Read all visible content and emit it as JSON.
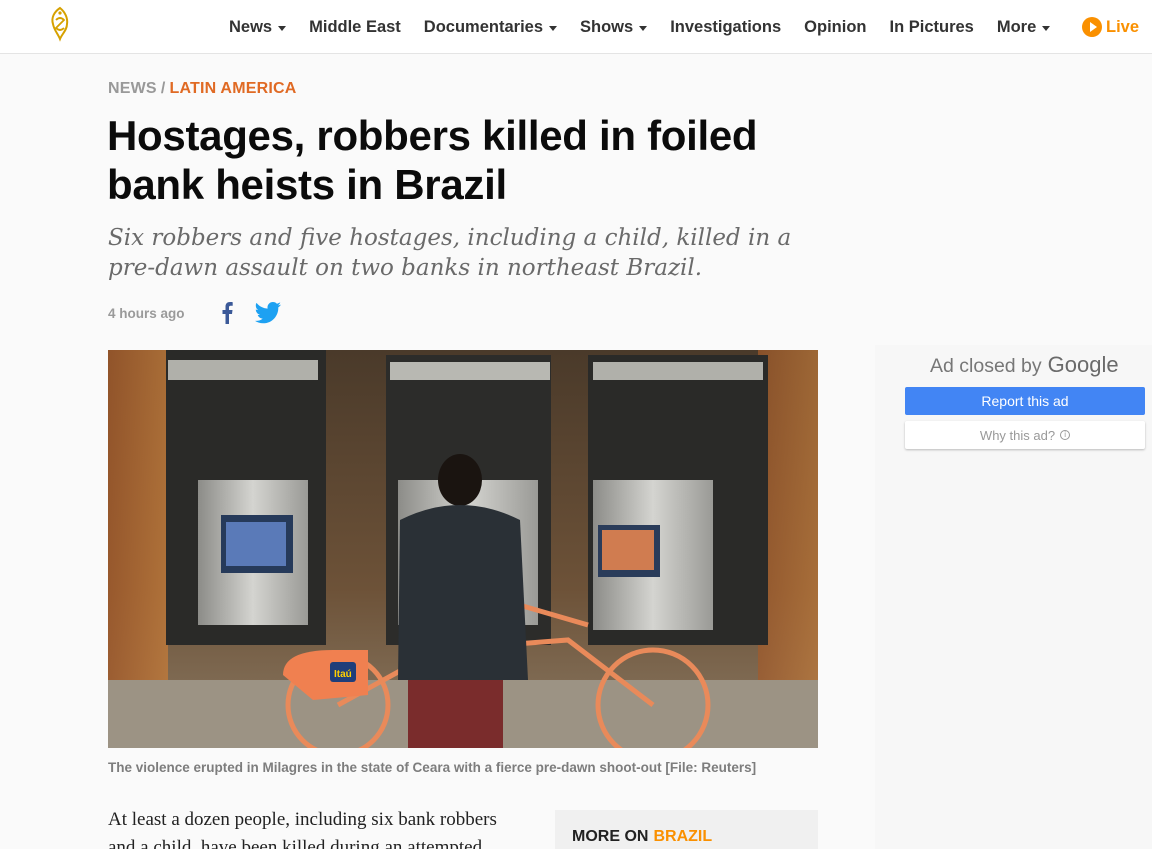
{
  "header": {
    "nav": [
      {
        "label": "News",
        "dropdown": true
      },
      {
        "label": "Middle East",
        "dropdown": false
      },
      {
        "label": "Documentaries",
        "dropdown": true
      },
      {
        "label": "Shows",
        "dropdown": true
      },
      {
        "label": "Investigations",
        "dropdown": false
      },
      {
        "label": "Opinion",
        "dropdown": false
      },
      {
        "label": "In Pictures",
        "dropdown": false
      },
      {
        "label": "More",
        "dropdown": true
      }
    ],
    "live_label": "Live",
    "accent_color": "#fa9000"
  },
  "article": {
    "breadcrumb": {
      "section": "NEWS",
      "separator": "/",
      "region": "LATIN AMERICA"
    },
    "headline": "Hostages, robbers killed in foiled bank heists in Brazil",
    "standfirst": "Six robbers and five hostages, including a child, killed in a pre-dawn assault on two banks in northeast Brazil.",
    "timestamp": "4 hours ago",
    "image_caption": "The violence erupted in Milagres in the state of Ceara with a fierce pre-dawn shoot-out [File: Reuters]",
    "atm_brand": "Itaú",
    "body_first_lines": "At least a dozen people, including six bank robbers and a child, have been killed during an attempted"
  },
  "more_on": {
    "label": "MORE ON",
    "topic": "BRAZIL"
  },
  "ad": {
    "closed_text": "Ad closed by",
    "brand": "Google",
    "report_label": "Report this ad",
    "why_label": "Why this ad?"
  }
}
